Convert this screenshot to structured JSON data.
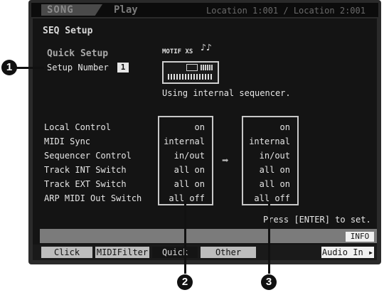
{
  "header": {
    "mode": "SONG",
    "screen": "Play",
    "location": "Location 1:001 / Location 2:001"
  },
  "page": {
    "title": "SEQ Setup",
    "section": "Quick Setup",
    "setup_number_label": "Setup Number",
    "setup_number_value": "1",
    "device_logo": "MOTIF XS",
    "status": "Using internal sequencer."
  },
  "settings": [
    {
      "label": "Local Control",
      "current": "on",
      "target": "on"
    },
    {
      "label": "MIDI Sync",
      "current": "internal",
      "target": "internal"
    },
    {
      "label": "Sequencer Control",
      "current": "in/out",
      "target": "in/out"
    },
    {
      "label": "Track INT Switch",
      "current": "all on",
      "target": "all on"
    },
    {
      "label": "Track EXT Switch",
      "current": "all on",
      "target": "all on"
    },
    {
      "label": "ARP MIDI Out Switch",
      "current": "all off",
      "target": "all off"
    }
  ],
  "arrow": "➡",
  "hint": "Press [ENTER] to set.",
  "info_button": "INFO",
  "tabs": [
    "Click",
    "MIDIFilter",
    "Quick",
    "Other"
  ],
  "active_tab": "Quick",
  "audio_in_button": "Audio In ▸",
  "callouts": [
    "1",
    "2",
    "3"
  ],
  "icons": {
    "notes": "♪♪",
    "keyboard": "keyboard-illustration"
  }
}
